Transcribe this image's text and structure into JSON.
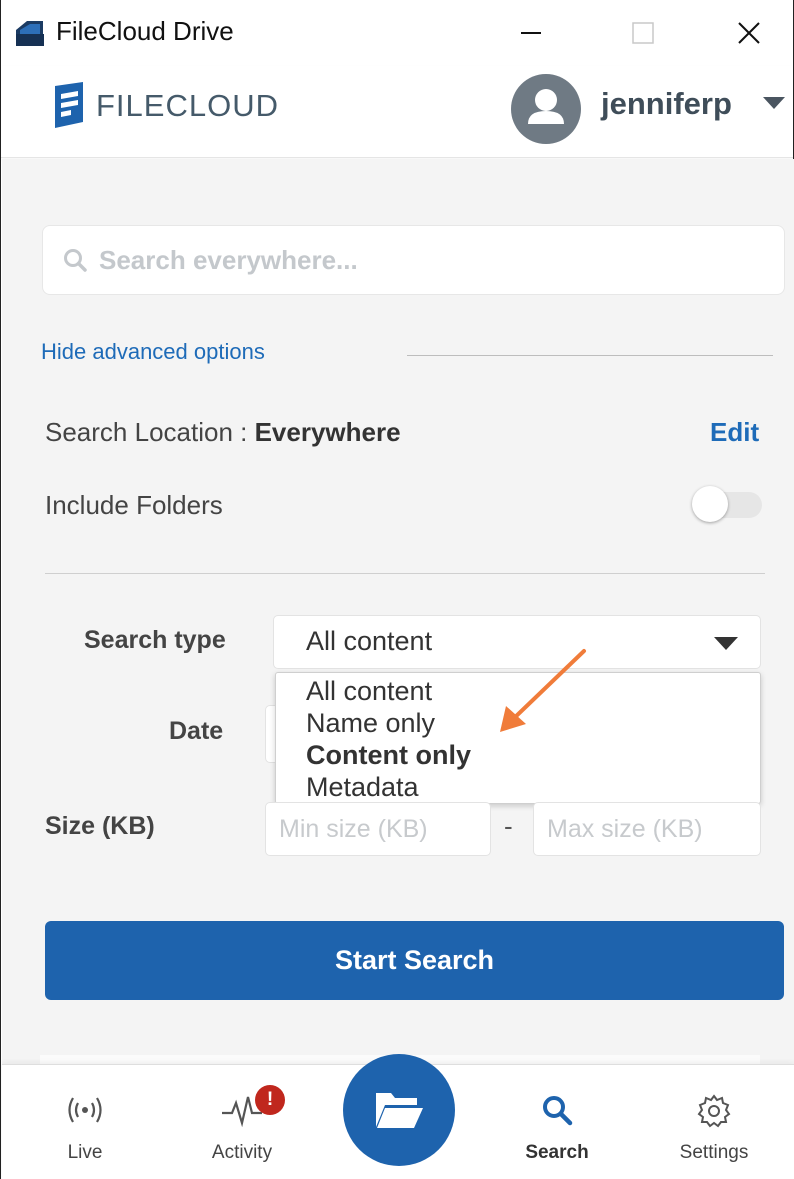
{
  "window": {
    "title": "FileCloud Drive"
  },
  "header": {
    "logo_text": "FILECLOUD",
    "username": "jenniferp"
  },
  "search": {
    "placeholder": "Search everywhere...",
    "value": ""
  },
  "advanced": {
    "toggle_label": "Hide advanced options",
    "location_label": "Search Location : ",
    "location_value": "Everywhere",
    "edit_label": "Edit",
    "include_folders_label": "Include Folders",
    "include_folders_on": false,
    "search_type_label": "Search type",
    "search_type_value": "All content",
    "search_type_options": [
      {
        "label": "All content",
        "selected": false
      },
      {
        "label": "Name only",
        "selected": false
      },
      {
        "label": "Content only",
        "selected": true
      },
      {
        "label": "Metadata",
        "selected": false
      }
    ],
    "date_label": "Date",
    "size_label": "Size (KB)",
    "size_min_placeholder": "Min size (KB)",
    "size_max_placeholder": "Max size (KB)",
    "size_separator": "-"
  },
  "actions": {
    "start_search_label": "Start Search"
  },
  "nav": {
    "items": [
      {
        "label": "Live",
        "icon": "live-signal-icon"
      },
      {
        "label": "Activity",
        "icon": "activity-pulse-icon",
        "badge": "!"
      },
      {
        "label": "Search",
        "icon": "search-icon",
        "active": true
      },
      {
        "label": "Settings",
        "icon": "gear-icon"
      }
    ],
    "fab_icon": "folder-open-icon"
  },
  "colors": {
    "accent": "#1e63ad",
    "link": "#1e6bb8",
    "badge": "#c0271d",
    "annotation_arrow": "#f07c3a",
    "panel_bg": "#f4f4f4"
  }
}
